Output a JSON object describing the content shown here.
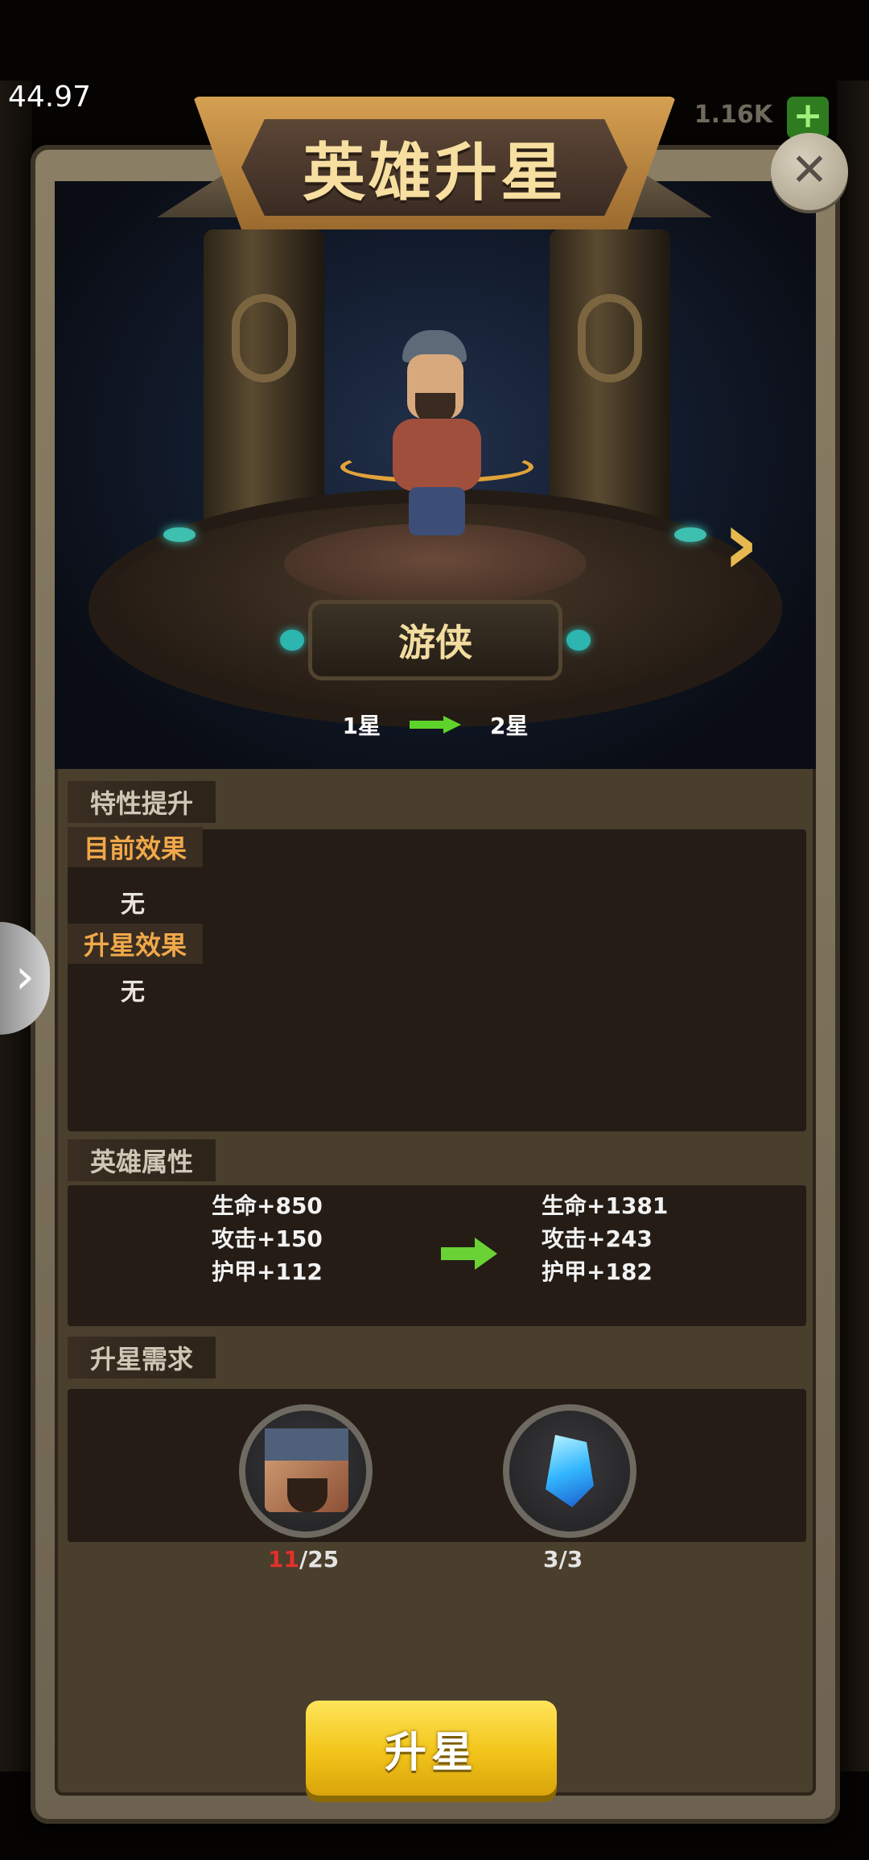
{
  "fps": "44.97",
  "top_bar": {
    "currency_value": "1.16K",
    "plus_label": "+"
  },
  "title": "英雄升星",
  "close_label": "✕",
  "side_tab_label": "›",
  "next_label": "›",
  "hero": {
    "name": "游侠",
    "star_from": "1星",
    "star_to": "2星"
  },
  "trait": {
    "section_label": "特性提升",
    "current_label": "目前效果",
    "current_value": "无",
    "upgrade_label": "升星效果",
    "upgrade_value": "无"
  },
  "attributes": {
    "section_label": "英雄属性",
    "current": [
      "生命+850",
      "攻击+150",
      "护甲+112"
    ],
    "next": [
      "生命+1381",
      "攻击+243",
      "护甲+182"
    ]
  },
  "requirements": {
    "section_label": "升星需求",
    "items": [
      {
        "icon": "hero-fragment-icon",
        "have": "11",
        "need": "/25"
      },
      {
        "icon": "crystal-icon",
        "count": "3/3"
      }
    ]
  },
  "upgrade_button": "升星",
  "colors": {
    "accent_gold": "#f2c41a",
    "arrow_green": "#6ad234",
    "insufficient_red": "#e0312a"
  }
}
